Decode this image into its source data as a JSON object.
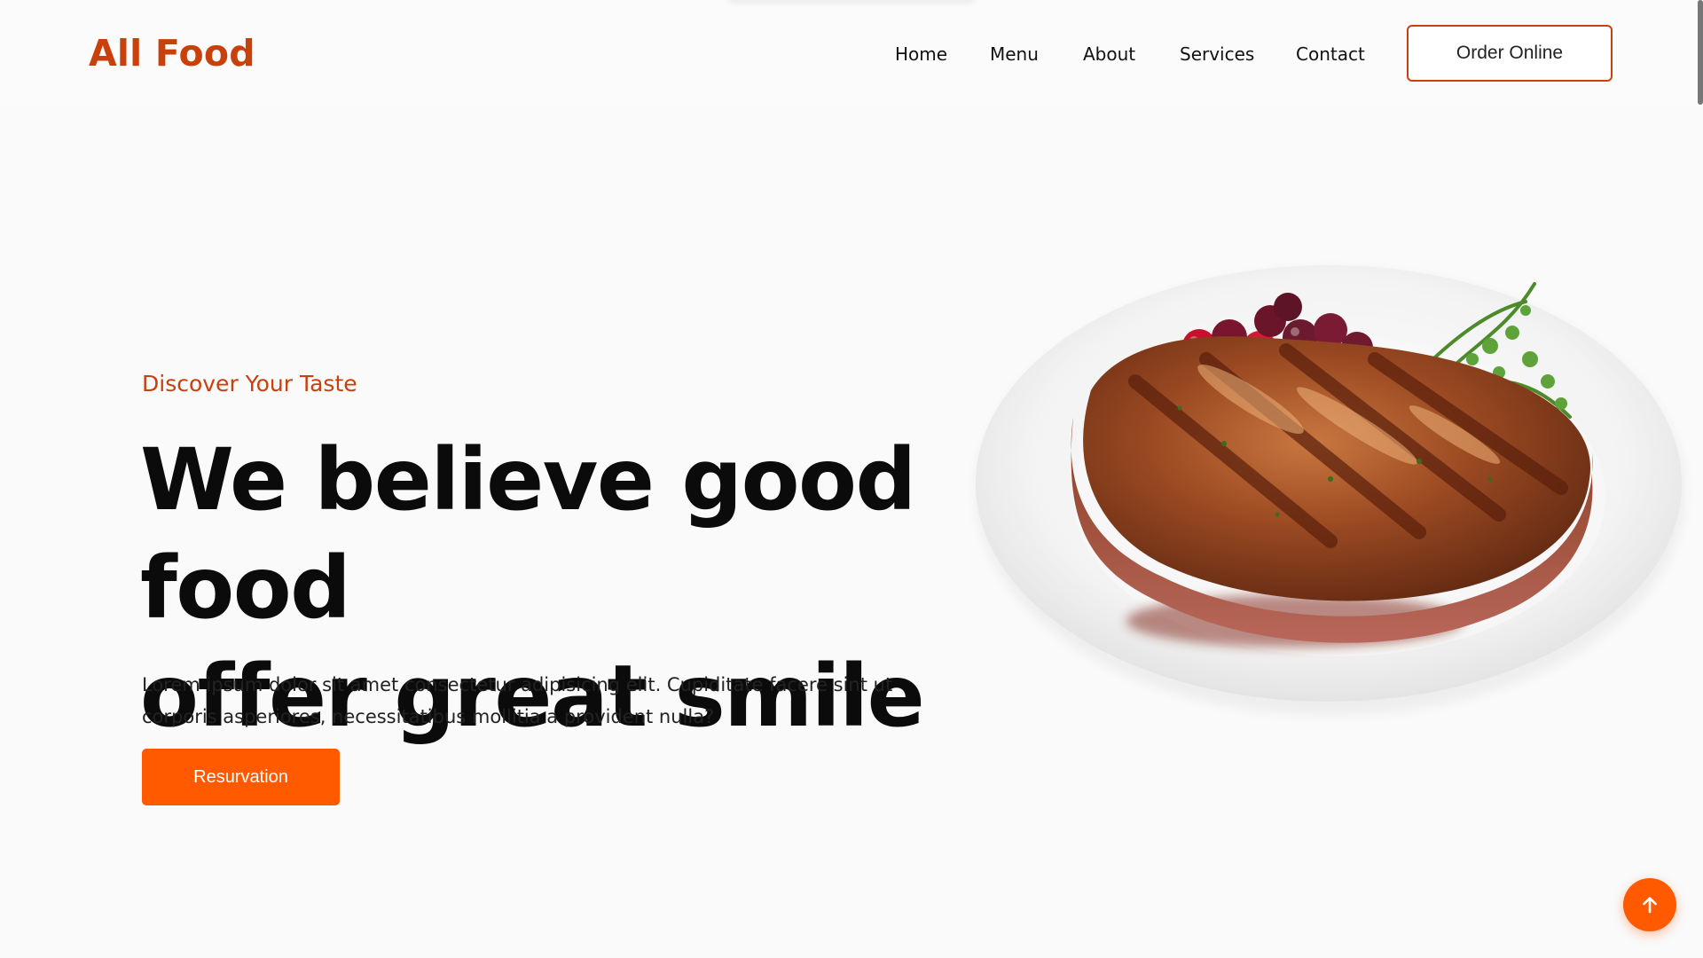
{
  "brand": {
    "name": "All Food",
    "accent": "#c8410d",
    "button_color": "#ff5a00"
  },
  "nav": {
    "items": [
      {
        "label": "Home"
      },
      {
        "label": "Menu"
      },
      {
        "label": "About"
      },
      {
        "label": "Services"
      },
      {
        "label": "Contact"
      }
    ],
    "cta_label": "Order Online"
  },
  "hero": {
    "eyebrow": "Discover Your Taste",
    "headline_line1": "We believe good food",
    "headline_line2": "offer great smile",
    "description": "Lorem ipsum dolor sit amet consectetur adipisicing elit. Cupiditate facere sint ut corporis asperiores, necessitatibus mollitia a provident nulla?",
    "button_label": "Resurvation"
  },
  "icons": {
    "scroll_top": "arrow-up-icon",
    "hero_image": "steak-plate-image"
  }
}
